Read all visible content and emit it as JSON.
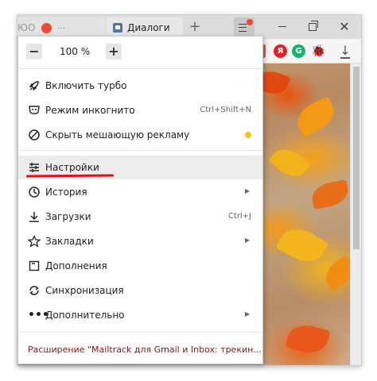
{
  "tabs": [
    {
      "title": "ЮО"
    },
    {
      "title": "..."
    },
    {
      "title": "Диалоги"
    }
  ],
  "toolbar": {
    "extensions": [
      "Я",
      "G"
    ]
  },
  "menu": {
    "zoom": {
      "minus": "−",
      "value": "100 %",
      "plus": "+"
    },
    "items": [
      {
        "label": "Включить турбо",
        "icon": "rocket-icon"
      },
      {
        "label": "Режим инкогнито",
        "icon": "incognito-icon",
        "shortcut": "Ctrl+Shift+N"
      },
      {
        "label": "Скрыть мешающую рекламу",
        "icon": "block-icon"
      },
      {
        "label": "Настройки",
        "icon": "settings-icon"
      },
      {
        "label": "История",
        "icon": "history-icon"
      },
      {
        "label": "Загрузки",
        "icon": "download-icon",
        "shortcut": "Ctrl+J"
      },
      {
        "label": "Закладки",
        "icon": "star-icon"
      },
      {
        "label": "Дополнения",
        "icon": "addons-icon"
      },
      {
        "label": "Синхронизация",
        "icon": "sync-icon"
      },
      {
        "label": "Дополнительно",
        "icon": "more-icon"
      }
    ],
    "extension_message": "Расширение \"Mailtrack для Gmail и Inbox: трекин..."
  },
  "colors": {
    "accent_red": "#e0101a",
    "notification_yellow": "#f5c518"
  }
}
